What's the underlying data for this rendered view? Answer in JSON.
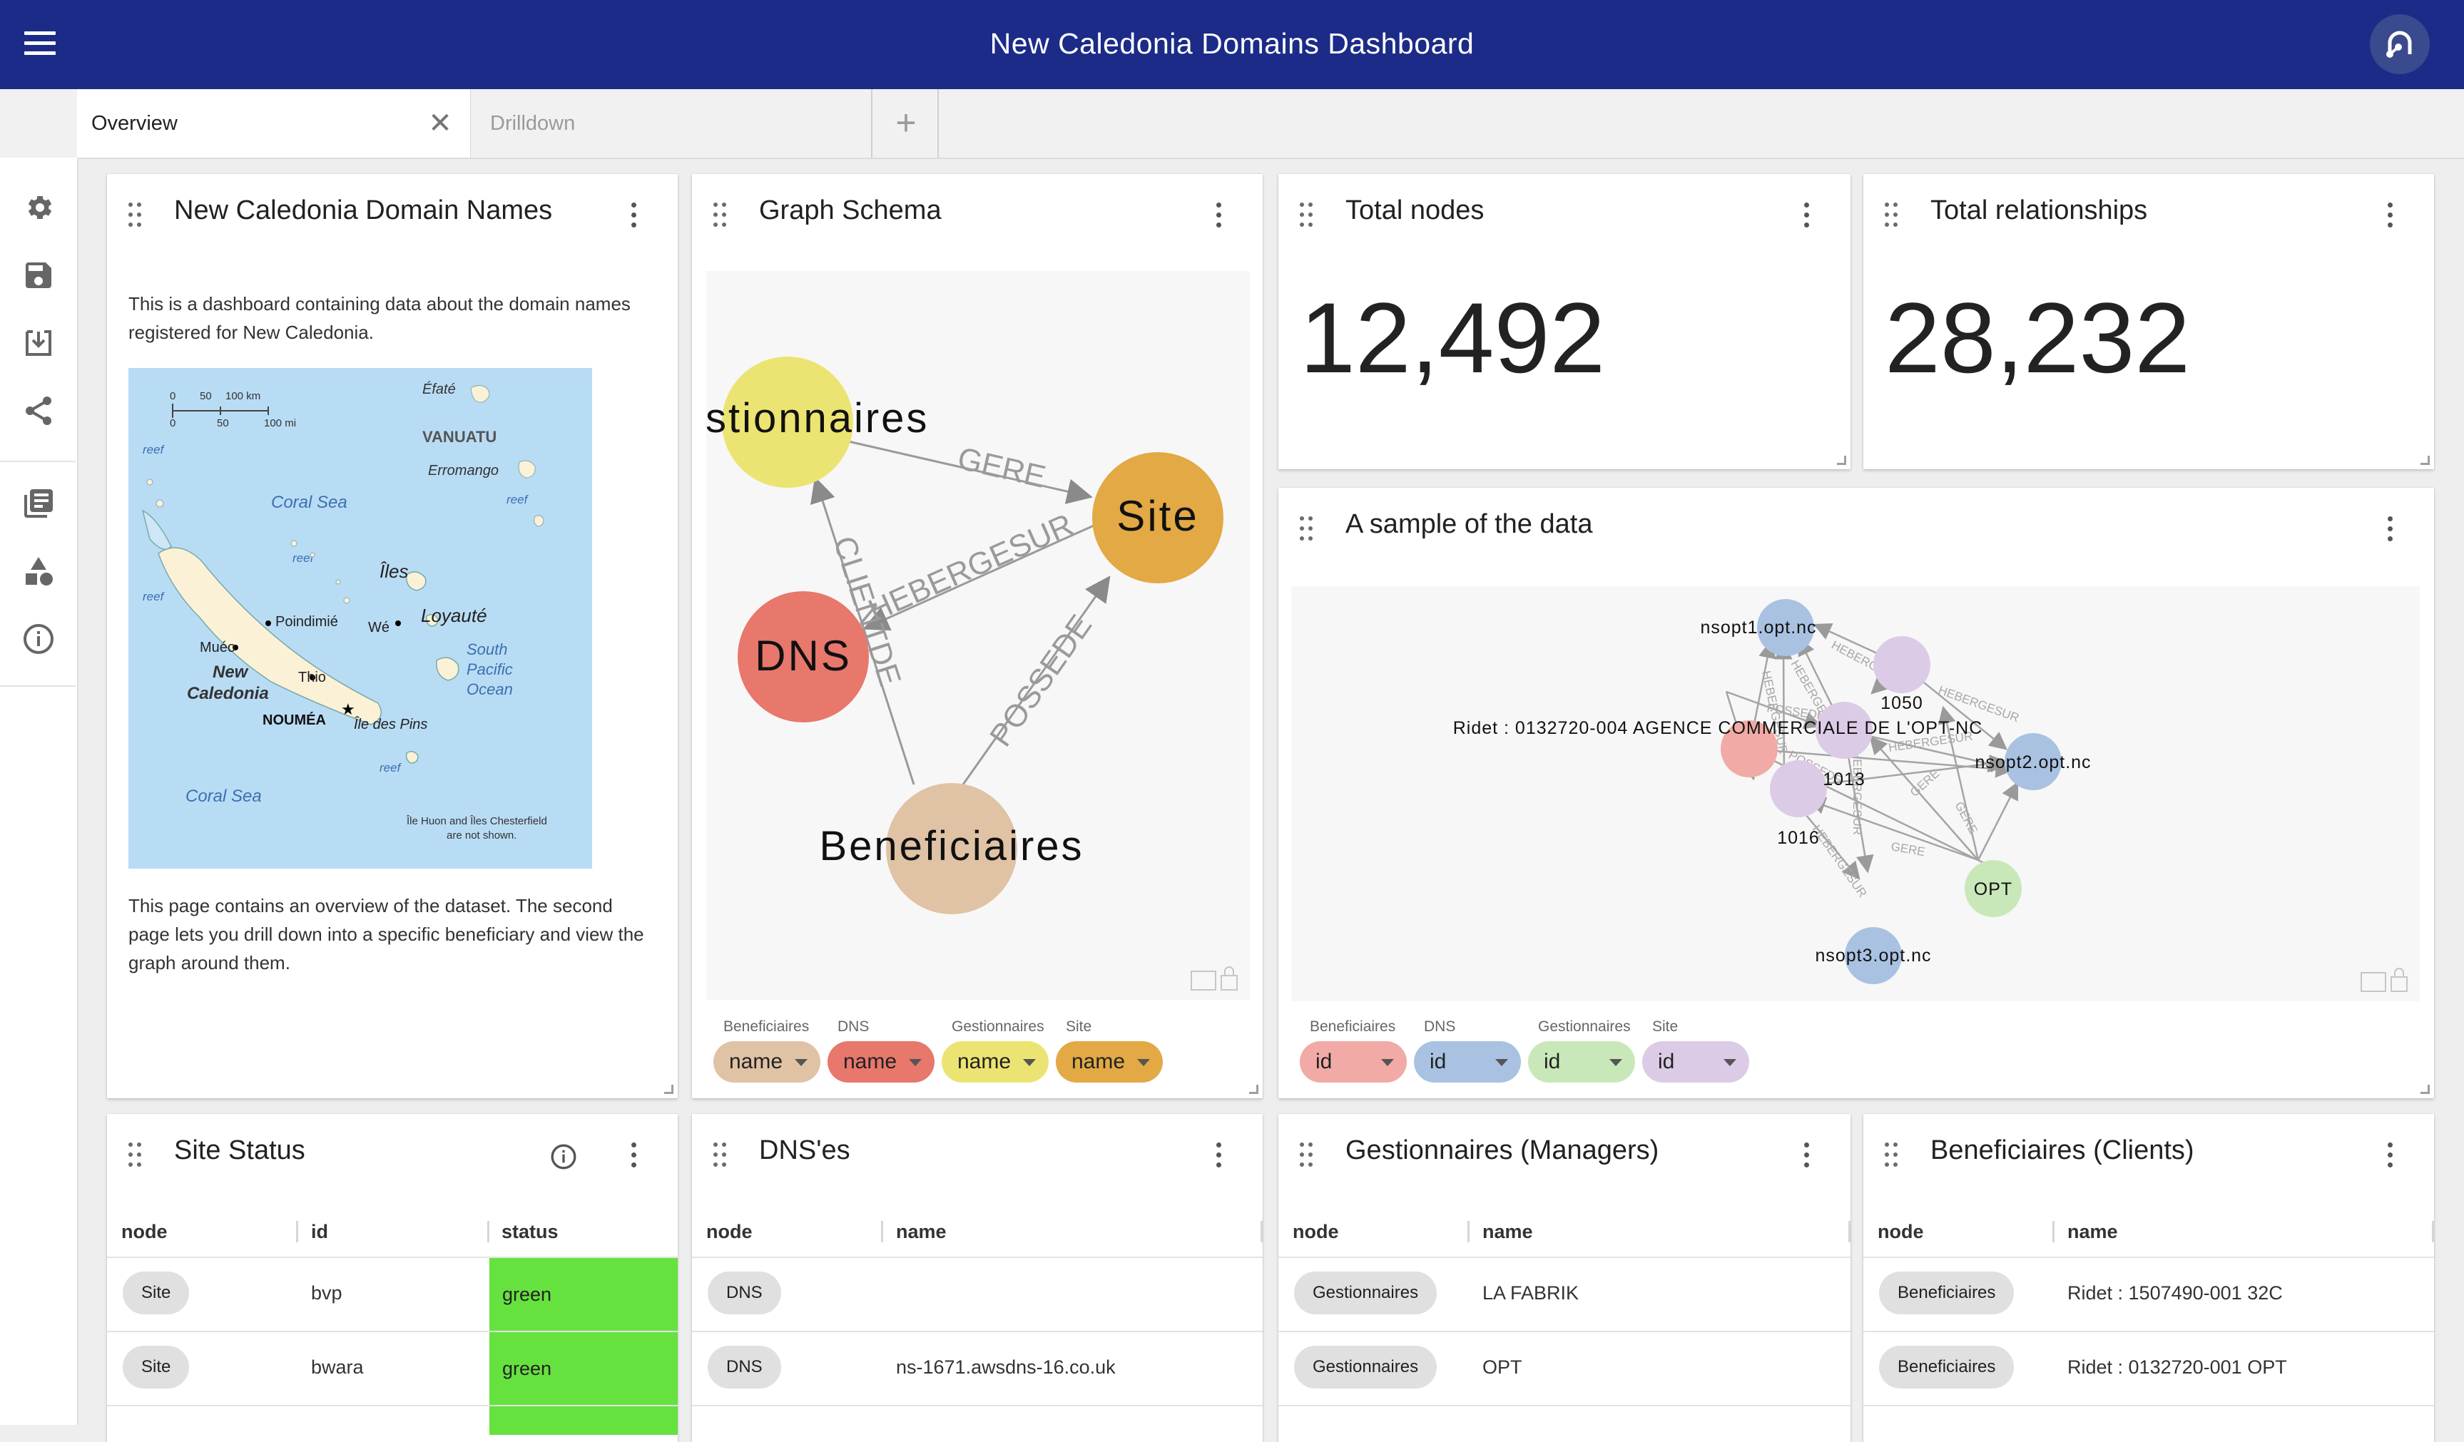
{
  "app": {
    "title": "New Caledonia Domains Dashboard"
  },
  "tabs": [
    {
      "label": "Overview",
      "active": true
    },
    {
      "label": "Drilldown",
      "active": false
    }
  ],
  "sidebar": {
    "icons": [
      "gear-icon",
      "save-icon",
      "download-icon",
      "share-icon",
      "library-icon",
      "shapes-icon",
      "info-icon"
    ]
  },
  "cards": {
    "domain_names": {
      "title": "New Caledonia Domain Names",
      "intro": "This is a dashboard containing data about the domain names registered for New Caledonia.",
      "outro": "This page contains an overview of the dataset. The second page lets you drill down into a specific beneficiary and view the graph around them.",
      "map": {
        "scale_top": [
          "0",
          "50",
          "100 km"
        ],
        "scale_bottom": [
          "0",
          "50",
          "100 mi"
        ],
        "efate": "Éfaté",
        "vanuatu": "VANUATU",
        "erromango": "Erromango",
        "coral_sea_top": "Coral Sea",
        "reef": "reef",
        "iles": "Îles",
        "loyaute": "Loyauté",
        "poindimie": "Poindimié",
        "we": "Wé",
        "mueo": "Muéo",
        "new": "New",
        "caledonia": "Caledonia",
        "thio": "Thio",
        "noumea": "NOUMÉA",
        "south_pacific": [
          "South",
          "Pacific",
          "Ocean"
        ],
        "ile_des_pins": "Île des Pins",
        "coral_sea_bottom": "Coral Sea",
        "footnote": [
          "Île Huon and Îles Chesterfield",
          "are not shown."
        ]
      }
    },
    "graph_schema": {
      "title": "Graph Schema",
      "nodes": {
        "gestionnaires": "Gestionnaires",
        "site": "Site",
        "dns": "DNS",
        "beneficiaires": "Beneficiaires"
      },
      "edges": {
        "gere": "GERE",
        "hebergesur": "HEBERGESUR",
        "clientde": "CLIENTDE",
        "possede": "POSSEDE"
      },
      "legend": [
        {
          "label": "Beneficiaires",
          "prop": "name",
          "color": "#e0c2a5"
        },
        {
          "label": "DNS",
          "prop": "name",
          "color": "#e8776c"
        },
        {
          "label": "Gestionnaires",
          "prop": "name",
          "color": "#ece472"
        },
        {
          "label": "Site",
          "prop": "name",
          "color": "#e2a944"
        }
      ]
    },
    "total_nodes": {
      "title": "Total nodes",
      "value": "12,492"
    },
    "total_relationships": {
      "title": "Total relationships",
      "value": "28,232"
    },
    "sample": {
      "title": "A sample of the data",
      "nodes": {
        "nsopt1": "nsopt1.opt.nc",
        "n1050": "1050",
        "ridet": "Ridet : 0132720-004 AGENCE COMMERCIALE DE L'OPT-NC",
        "n1013": "1013",
        "nsopt2": "nsopt2.opt.nc",
        "n1016": "1016",
        "opt": "OPT",
        "nsopt3": "nsopt3.opt.nc"
      },
      "edges": {
        "hebergesur": "HEBERGESUR",
        "possede": "POSSEDE",
        "gere": "GERE"
      },
      "legend": [
        {
          "label": "Beneficiaires",
          "prop": "id",
          "color": "#f1aaa5"
        },
        {
          "label": "DNS",
          "prop": "id",
          "color": "#a9c2e2"
        },
        {
          "label": "Gestionnaires",
          "prop": "id",
          "color": "#c9e8b9"
        },
        {
          "label": "Site",
          "prop": "id",
          "color": "#dccbe6"
        }
      ]
    },
    "site_status": {
      "title": "Site Status",
      "columns": [
        "node",
        "id",
        "status"
      ],
      "rows": [
        {
          "node": "Site",
          "id": "bvp",
          "status": "green"
        },
        {
          "node": "Site",
          "id": "bwara",
          "status": "green"
        }
      ]
    },
    "dnses": {
      "title": "DNS'es",
      "columns": [
        "node",
        "name"
      ],
      "rows": [
        {
          "node": "DNS",
          "name": ""
        },
        {
          "node": "DNS",
          "name": "ns-1671.awsdns-16.co.uk"
        }
      ]
    },
    "gestionnaires": {
      "title": "Gestionnaires (Managers)",
      "columns": [
        "node",
        "name"
      ],
      "rows": [
        {
          "node": "Gestionnaires",
          "name": "LA FABRIK"
        },
        {
          "node": "Gestionnaires",
          "name": "OPT"
        }
      ]
    },
    "beneficiaires": {
      "title": "Beneficiaires (Clients)",
      "columns": [
        "node",
        "name"
      ],
      "rows": [
        {
          "node": "Beneficiaires",
          "name": "Ridet : 1507490-001 32C"
        },
        {
          "node": "Beneficiaires",
          "name": "Ridet : 0132720-001 OPT"
        }
      ]
    }
  }
}
